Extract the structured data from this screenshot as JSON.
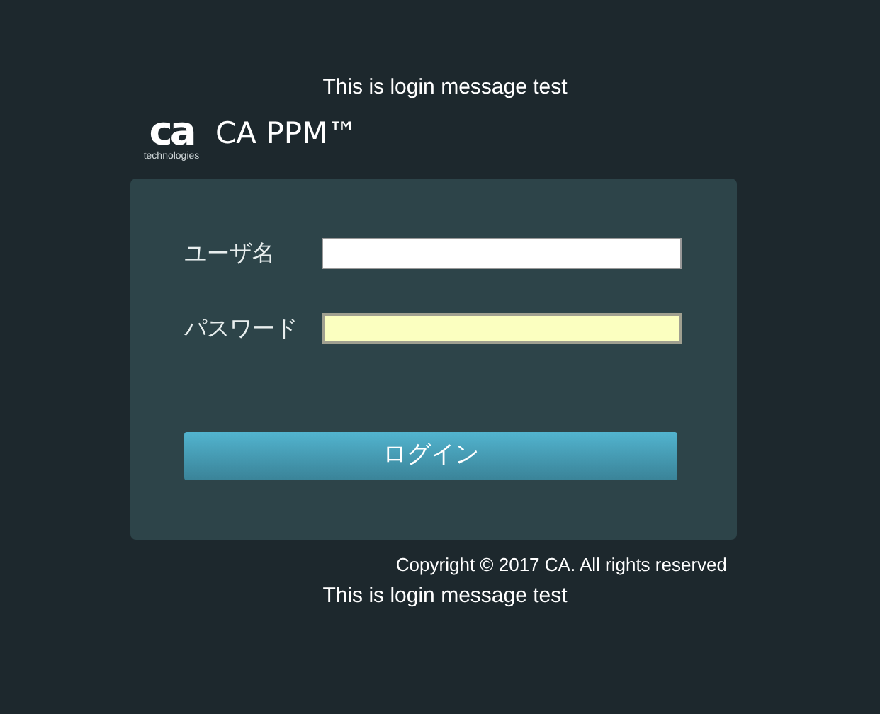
{
  "top_message": "This is login message test",
  "logo": {
    "mark": "ca",
    "tagline": "technologies"
  },
  "product": "CA PPM™",
  "fields": [
    {
      "label": "ユーザ名",
      "highlighted": false
    },
    {
      "label": "パスワード",
      "highlighted": true
    }
  ],
  "login_button": "ログイン",
  "copyright": "Copyright © 2017 CA. All rights reserved",
  "bottom_message": "This is login message test"
}
